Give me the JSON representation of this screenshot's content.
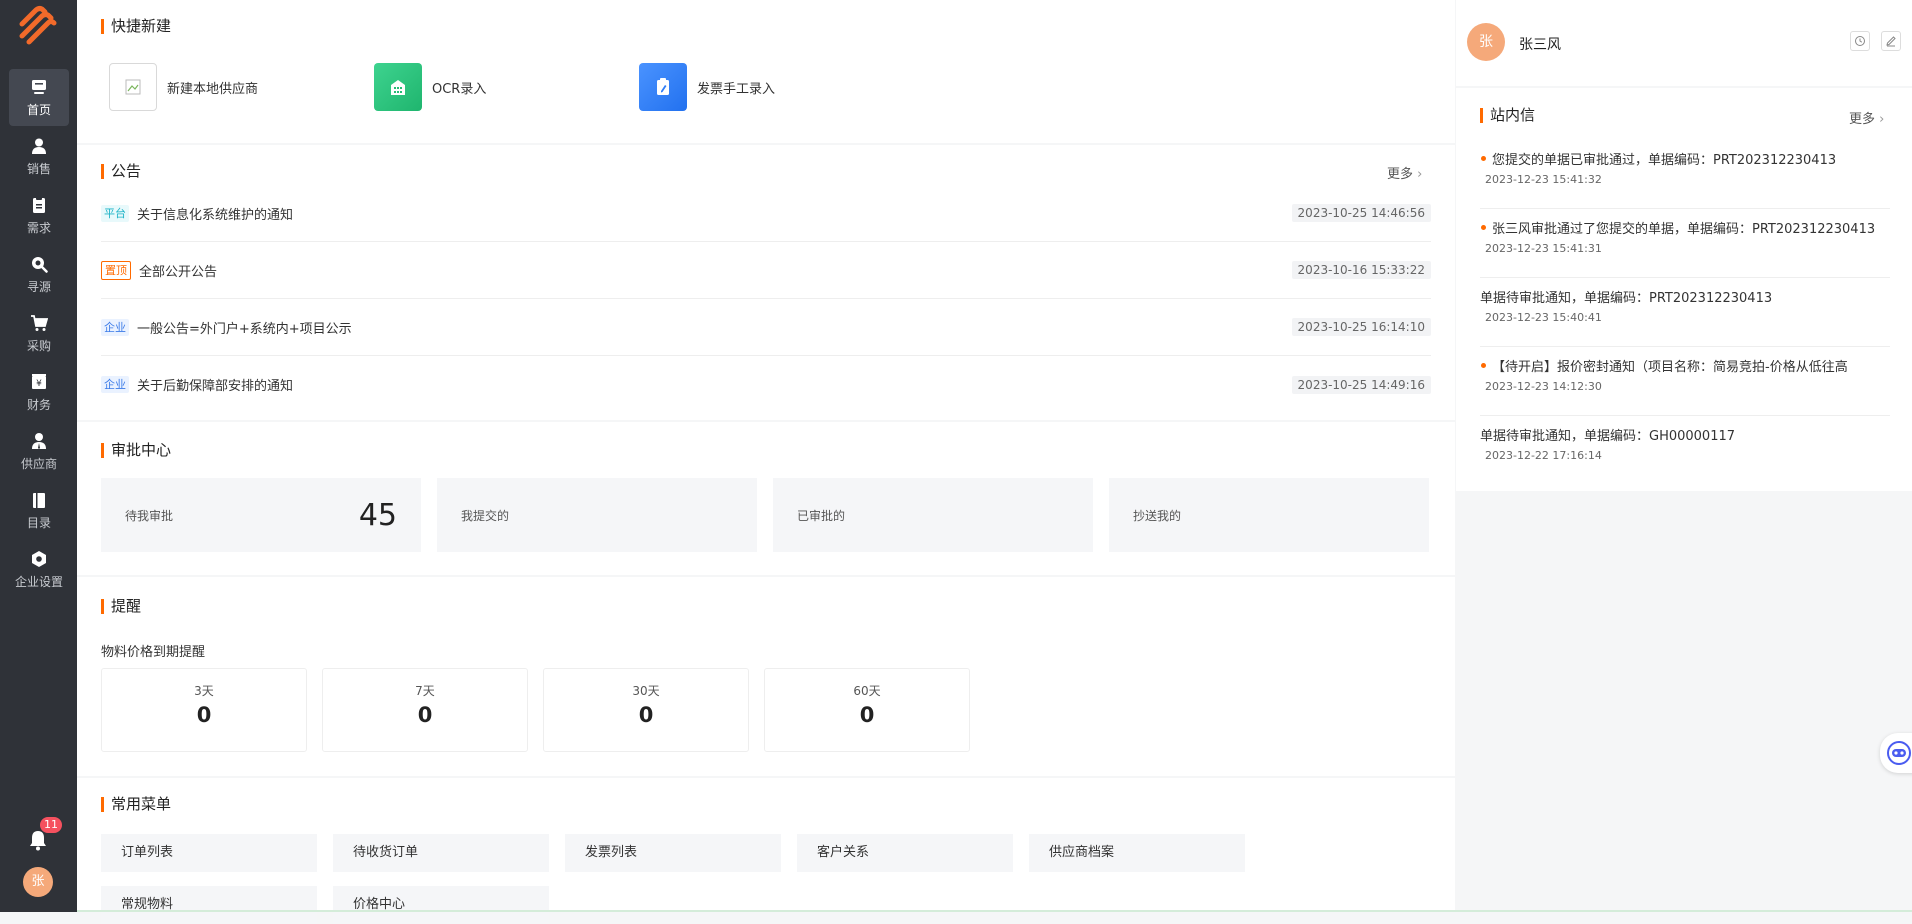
{
  "sidebar": {
    "items": [
      {
        "label": "首页",
        "icon": "home-icon"
      },
      {
        "label": "销售",
        "icon": "person-icon"
      },
      {
        "label": "需求",
        "icon": "clipboard-icon"
      },
      {
        "label": "寻源",
        "icon": "search-icon"
      },
      {
        "label": "采购",
        "icon": "cart-icon"
      },
      {
        "label": "财务",
        "icon": "finance-icon"
      },
      {
        "label": "供应商",
        "icon": "supplier-icon"
      },
      {
        "label": "目录",
        "icon": "book-icon"
      },
      {
        "label": "企业设置",
        "icon": "gear-icon"
      }
    ],
    "notification_count": "11",
    "avatar_text": "张"
  },
  "quick_create": {
    "title": "快捷新建",
    "items": [
      {
        "label": "新建本地供应商",
        "icon": "broken-image-icon"
      },
      {
        "label": "OCR录入",
        "icon": "building-icon",
        "color": "#2bc37b"
      },
      {
        "label": "发票手工录入",
        "icon": "invoice-icon",
        "color": "#2f7df6"
      }
    ]
  },
  "announcements": {
    "title": "公告",
    "more": "更多",
    "rows": [
      {
        "tag": "平台",
        "text": "关于信息化系统维护的通知",
        "time": "2023-10-25 14:46:56"
      },
      {
        "tag": "置顶",
        "text": "全部公开公告",
        "time": "2023-10-16 15:33:22"
      },
      {
        "tag": "企业",
        "text": "一般公告=外门户+系统内+项目公示",
        "time": "2023-10-25 16:14:10"
      },
      {
        "tag": "企业",
        "text": "关于后勤保障部安排的通知",
        "time": "2023-10-25 14:49:16"
      }
    ]
  },
  "approval": {
    "title": "审批中心",
    "boxes": [
      {
        "label": "待我审批",
        "count": "45"
      },
      {
        "label": "我提交的",
        "count": ""
      },
      {
        "label": "已审批的",
        "count": ""
      },
      {
        "label": "抄送我的",
        "count": ""
      }
    ]
  },
  "reminder": {
    "title": "提醒",
    "subtitle": "物料价格到期提醒",
    "boxes": [
      {
        "day": "3天",
        "count": "0"
      },
      {
        "day": "7天",
        "count": "0"
      },
      {
        "day": "30天",
        "count": "0"
      },
      {
        "day": "60天",
        "count": "0"
      }
    ]
  },
  "common_menu": {
    "title": "常用菜单",
    "items": [
      "订单列表",
      "待收货订单",
      "发票列表",
      "客户关系",
      "供应商档案",
      "常规物料",
      "价格中心"
    ]
  },
  "user": {
    "avatar_text": "张",
    "name": "张三风"
  },
  "messages": {
    "title": "站内信",
    "more": "更多",
    "items": [
      {
        "text": "您提交的单据已审批通过，单据编码：PRT202312230413",
        "time": "2023-12-23 15:41:32",
        "unread": true
      },
      {
        "text": "张三风审批通过了您提交的单据，单据编码：PRT202312230413",
        "time": "2023-12-23 15:41:31",
        "unread": true
      },
      {
        "text": "单据待审批通知，单据编码：PRT202312230413",
        "time": "2023-12-23 15:40:41",
        "unread": false
      },
      {
        "text": "【待开启】报价密封通知（项目名称：简易竞拍-价格从低往高",
        "time": "2023-12-23 14:12:30",
        "unread": true
      },
      {
        "text": "单据待审批通知，单据编码：GH00000117",
        "time": "2023-12-22 17:16:14",
        "unread": false
      }
    ]
  },
  "colors": {
    "accent": "#ff6a00",
    "sidebar_bg": "#2f3238",
    "badge": "#f5515f"
  }
}
